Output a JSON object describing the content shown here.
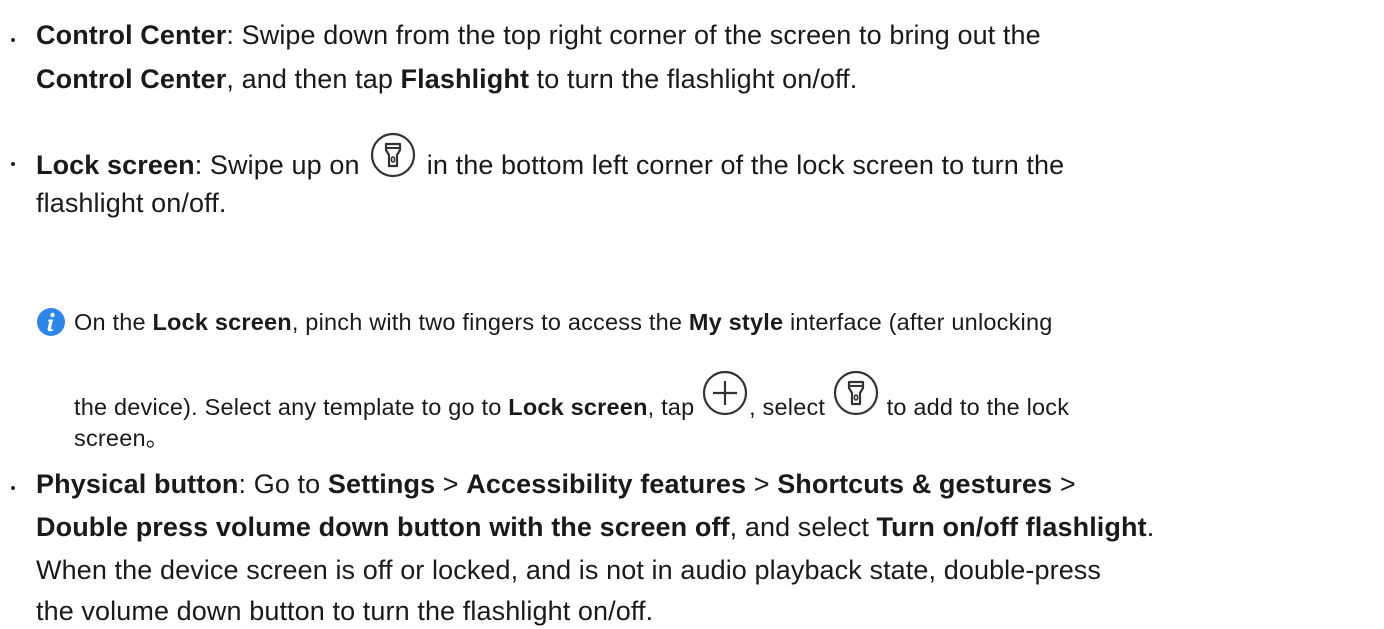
{
  "colors": {
    "text": "#1a1a1a",
    "info_icon": "#2f86e8",
    "icon_stroke": "#333333"
  },
  "item1": {
    "label": "Control Center",
    "line1_text": ": Swipe down from the top right corner of the screen to bring out the",
    "line2_bold": "Control Center",
    "line2_mid": ", and then tap ",
    "line2_bold2": "Flashlight",
    "line2_end": " to turn the flashlight on/off."
  },
  "item2": {
    "label": "Lock screen",
    "line1_text": ": Swipe up on ",
    "line1_after_icon": " in the bottom left corner of the lock screen to turn the",
    "line2": "flashlight on/off.",
    "icon": "flashlight-icon"
  },
  "note": {
    "icon": "info-icon",
    "line1_a": "On the ",
    "line1_b": "Lock screen",
    "line1_c": ", pinch with two fingers to access the ",
    "line1_d": "My style",
    "line1_e": " interface (after unlocking",
    "line2_a": "the device). Select any template to go to ",
    "line2_b": "Lock screen",
    "line2_c": ", tap ",
    "line2_d": ", select ",
    "line2_e": " to add to the lock",
    "line3": "screen。",
    "plus_icon": "add-circle-icon",
    "flash_icon": "flashlight-icon"
  },
  "item3": {
    "label": "Physical button",
    "line1_a": ": Go to ",
    "line1_b": "Settings",
    "line1_c": " > ",
    "line1_d": "Accessibility features",
    "line1_e": " > ",
    "line1_f": "Shortcuts & gestures",
    "line1_g": " >",
    "line2_a": "Double press volume down button with the screen off",
    "line2_b": ", and select ",
    "line2_c": "Turn on/off flashlight",
    "line2_d": ".",
    "line3": "When the device screen is off or locked, and is not in audio playback state, double-press",
    "line4": "the volume down button to turn the flashlight on/off."
  }
}
